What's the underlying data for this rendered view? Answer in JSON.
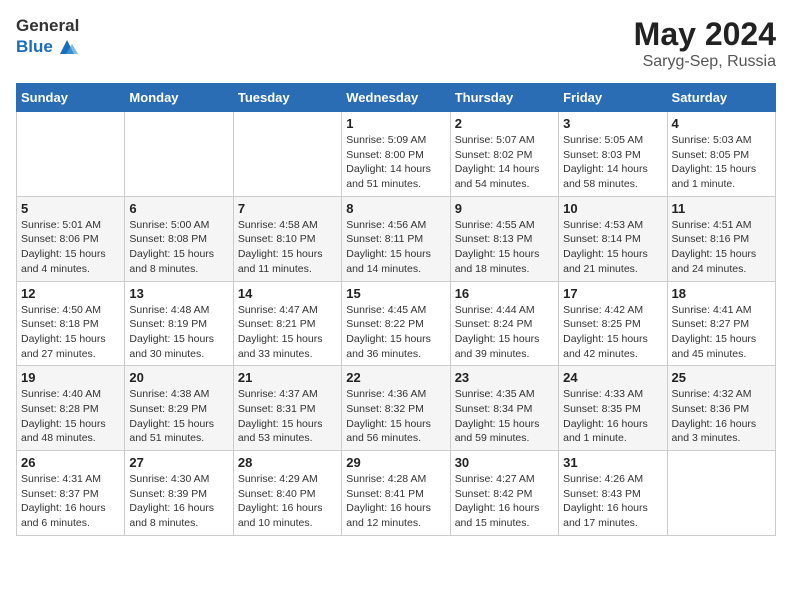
{
  "header": {
    "logo_general": "General",
    "logo_blue": "Blue",
    "month": "May 2024",
    "location": "Saryg-Sep, Russia"
  },
  "days_of_week": [
    "Sunday",
    "Monday",
    "Tuesday",
    "Wednesday",
    "Thursday",
    "Friday",
    "Saturday"
  ],
  "weeks": [
    [
      {
        "day": "",
        "info": ""
      },
      {
        "day": "",
        "info": ""
      },
      {
        "day": "",
        "info": ""
      },
      {
        "day": "1",
        "info": "Sunrise: 5:09 AM\nSunset: 8:00 PM\nDaylight: 14 hours and 51 minutes."
      },
      {
        "day": "2",
        "info": "Sunrise: 5:07 AM\nSunset: 8:02 PM\nDaylight: 14 hours and 54 minutes."
      },
      {
        "day": "3",
        "info": "Sunrise: 5:05 AM\nSunset: 8:03 PM\nDaylight: 14 hours and 58 minutes."
      },
      {
        "day": "4",
        "info": "Sunrise: 5:03 AM\nSunset: 8:05 PM\nDaylight: 15 hours and 1 minute."
      }
    ],
    [
      {
        "day": "5",
        "info": "Sunrise: 5:01 AM\nSunset: 8:06 PM\nDaylight: 15 hours and 4 minutes."
      },
      {
        "day": "6",
        "info": "Sunrise: 5:00 AM\nSunset: 8:08 PM\nDaylight: 15 hours and 8 minutes."
      },
      {
        "day": "7",
        "info": "Sunrise: 4:58 AM\nSunset: 8:10 PM\nDaylight: 15 hours and 11 minutes."
      },
      {
        "day": "8",
        "info": "Sunrise: 4:56 AM\nSunset: 8:11 PM\nDaylight: 15 hours and 14 minutes."
      },
      {
        "day": "9",
        "info": "Sunrise: 4:55 AM\nSunset: 8:13 PM\nDaylight: 15 hours and 18 minutes."
      },
      {
        "day": "10",
        "info": "Sunrise: 4:53 AM\nSunset: 8:14 PM\nDaylight: 15 hours and 21 minutes."
      },
      {
        "day": "11",
        "info": "Sunrise: 4:51 AM\nSunset: 8:16 PM\nDaylight: 15 hours and 24 minutes."
      }
    ],
    [
      {
        "day": "12",
        "info": "Sunrise: 4:50 AM\nSunset: 8:18 PM\nDaylight: 15 hours and 27 minutes."
      },
      {
        "day": "13",
        "info": "Sunrise: 4:48 AM\nSunset: 8:19 PM\nDaylight: 15 hours and 30 minutes."
      },
      {
        "day": "14",
        "info": "Sunrise: 4:47 AM\nSunset: 8:21 PM\nDaylight: 15 hours and 33 minutes."
      },
      {
        "day": "15",
        "info": "Sunrise: 4:45 AM\nSunset: 8:22 PM\nDaylight: 15 hours and 36 minutes."
      },
      {
        "day": "16",
        "info": "Sunrise: 4:44 AM\nSunset: 8:24 PM\nDaylight: 15 hours and 39 minutes."
      },
      {
        "day": "17",
        "info": "Sunrise: 4:42 AM\nSunset: 8:25 PM\nDaylight: 15 hours and 42 minutes."
      },
      {
        "day": "18",
        "info": "Sunrise: 4:41 AM\nSunset: 8:27 PM\nDaylight: 15 hours and 45 minutes."
      }
    ],
    [
      {
        "day": "19",
        "info": "Sunrise: 4:40 AM\nSunset: 8:28 PM\nDaylight: 15 hours and 48 minutes."
      },
      {
        "day": "20",
        "info": "Sunrise: 4:38 AM\nSunset: 8:29 PM\nDaylight: 15 hours and 51 minutes."
      },
      {
        "day": "21",
        "info": "Sunrise: 4:37 AM\nSunset: 8:31 PM\nDaylight: 15 hours and 53 minutes."
      },
      {
        "day": "22",
        "info": "Sunrise: 4:36 AM\nSunset: 8:32 PM\nDaylight: 15 hours and 56 minutes."
      },
      {
        "day": "23",
        "info": "Sunrise: 4:35 AM\nSunset: 8:34 PM\nDaylight: 15 hours and 59 minutes."
      },
      {
        "day": "24",
        "info": "Sunrise: 4:33 AM\nSunset: 8:35 PM\nDaylight: 16 hours and 1 minute."
      },
      {
        "day": "25",
        "info": "Sunrise: 4:32 AM\nSunset: 8:36 PM\nDaylight: 16 hours and 3 minutes."
      }
    ],
    [
      {
        "day": "26",
        "info": "Sunrise: 4:31 AM\nSunset: 8:37 PM\nDaylight: 16 hours and 6 minutes."
      },
      {
        "day": "27",
        "info": "Sunrise: 4:30 AM\nSunset: 8:39 PM\nDaylight: 16 hours and 8 minutes."
      },
      {
        "day": "28",
        "info": "Sunrise: 4:29 AM\nSunset: 8:40 PM\nDaylight: 16 hours and 10 minutes."
      },
      {
        "day": "29",
        "info": "Sunrise: 4:28 AM\nSunset: 8:41 PM\nDaylight: 16 hours and 12 minutes."
      },
      {
        "day": "30",
        "info": "Sunrise: 4:27 AM\nSunset: 8:42 PM\nDaylight: 16 hours and 15 minutes."
      },
      {
        "day": "31",
        "info": "Sunrise: 4:26 AM\nSunset: 8:43 PM\nDaylight: 16 hours and 17 minutes."
      },
      {
        "day": "",
        "info": ""
      }
    ]
  ]
}
